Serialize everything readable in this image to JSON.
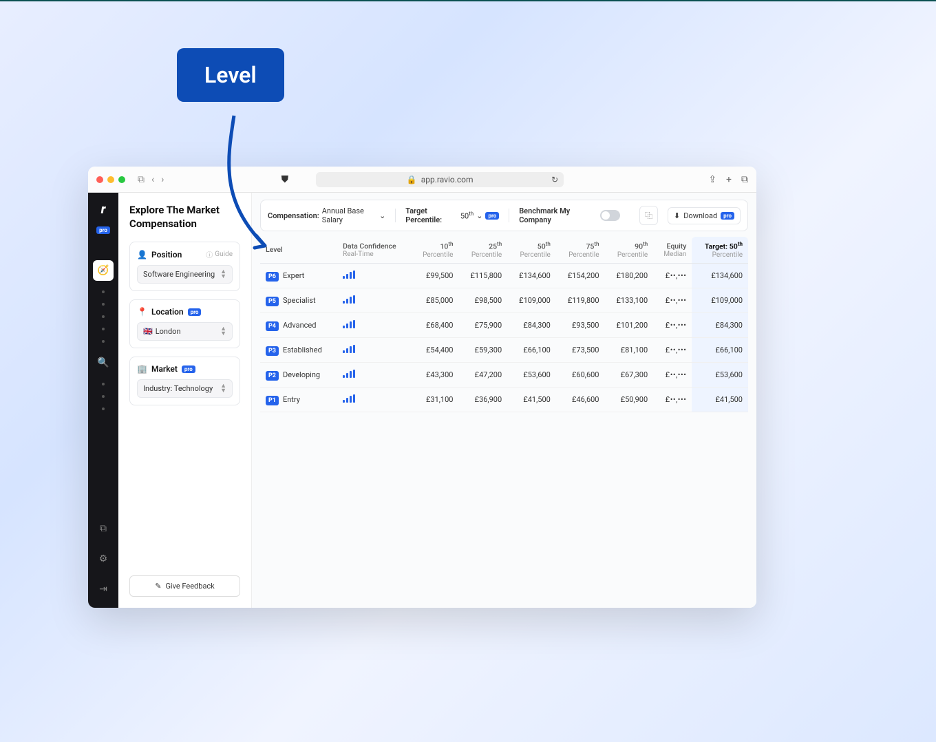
{
  "annotation": {
    "label": "Level"
  },
  "browser": {
    "url": "app.ravio.com"
  },
  "sidebar": {
    "logo": "r",
    "pro": "pro"
  },
  "leftPanel": {
    "title": "Explore The Market Compensation",
    "position": {
      "label": "Position",
      "guide": "Guide",
      "value": "Software Engineering"
    },
    "location": {
      "label": "Location",
      "pro": "pro",
      "value": "London",
      "flag": "🇬🇧"
    },
    "market": {
      "label": "Market",
      "pro": "pro",
      "value": "Industry: Technology"
    },
    "feedback": "Give Feedback"
  },
  "toolbar": {
    "compensationLabel": "Compensation:",
    "compensationValue": "Annual Base Salary",
    "targetLabel": "Target Percentile:",
    "targetValue": "50",
    "targetSup": "th",
    "pro": "pro",
    "benchmark": "Benchmark My Company",
    "download": "Download"
  },
  "table": {
    "headers": {
      "level": "Level",
      "confidence": "Data Confidence",
      "confidenceSub": "Real-Time",
      "p10": "10",
      "p10sup": "th",
      "p25": "25",
      "p25sup": "th",
      "p50": "50",
      "p50sup": "th",
      "p75": "75",
      "p75sup": "th",
      "p90": "90",
      "p90sup": "th",
      "percentileSub": "Percentile",
      "equity": "Equity",
      "equitySub": "Median",
      "target": "Target: 50",
      "targetSup": "th"
    },
    "rows": [
      {
        "badge": "P6",
        "name": "Expert",
        "p10": "£99,500",
        "p25": "£115,800",
        "p50": "£134,600",
        "p75": "£154,200",
        "p90": "£180,200",
        "equity": "£••,•••",
        "target": "£134,600"
      },
      {
        "badge": "P5",
        "name": "Specialist",
        "p10": "£85,000",
        "p25": "£98,500",
        "p50": "£109,000",
        "p75": "£119,800",
        "p90": "£133,100",
        "equity": "£••,•••",
        "target": "£109,000"
      },
      {
        "badge": "P4",
        "name": "Advanced",
        "p10": "£68,400",
        "p25": "£75,900",
        "p50": "£84,300",
        "p75": "£93,500",
        "p90": "£101,200",
        "equity": "£••,•••",
        "target": "£84,300"
      },
      {
        "badge": "P3",
        "name": "Established",
        "p10": "£54,400",
        "p25": "£59,300",
        "p50": "£66,100",
        "p75": "£73,500",
        "p90": "£81,100",
        "equity": "£••,•••",
        "target": "£66,100"
      },
      {
        "badge": "P2",
        "name": "Developing",
        "p10": "£43,300",
        "p25": "£47,200",
        "p50": "£53,600",
        "p75": "£60,600",
        "p90": "£67,300",
        "equity": "£••,•••",
        "target": "£53,600"
      },
      {
        "badge": "P1",
        "name": "Entry",
        "p10": "£31,100",
        "p25": "£36,900",
        "p50": "£41,500",
        "p75": "£46,600",
        "p90": "£50,900",
        "equity": "£••,•••",
        "target": "£41,500"
      }
    ]
  }
}
